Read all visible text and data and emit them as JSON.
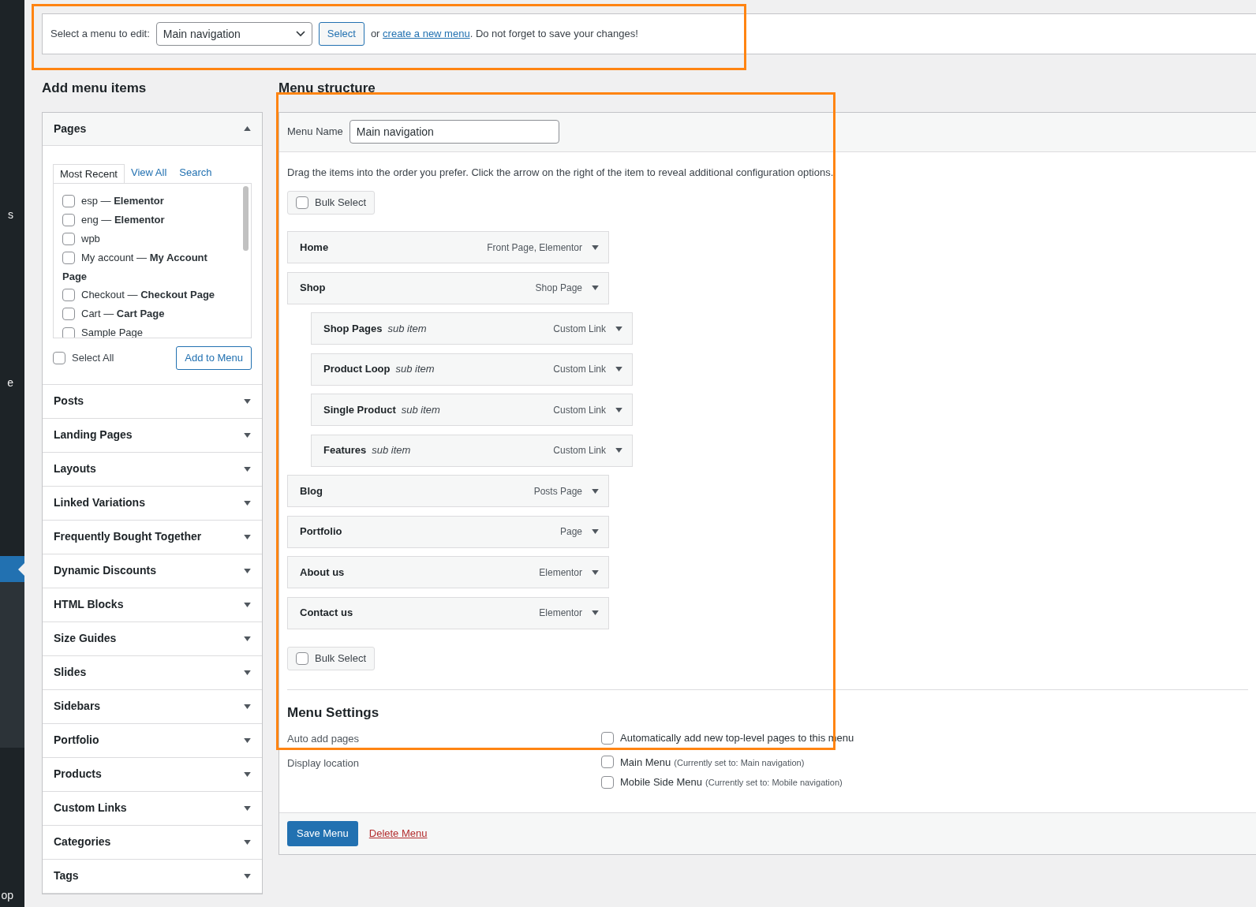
{
  "admin_sidebar": {
    "cut_labels": [
      "s",
      "e",
      "op"
    ]
  },
  "menu_select_bar": {
    "label": "Select a menu to edit:",
    "dropdown_value": "Main navigation",
    "button": "Select",
    "text_before_link": "or",
    "link": "create a new menu",
    "text_after_link": ". Do not forget to save your changes!"
  },
  "add_menu_items": {
    "title": "Add menu items",
    "panels": [
      {
        "title": "Pages",
        "expanded": true,
        "tabs": [
          {
            "label": "Most Recent",
            "selected": true
          },
          {
            "label": "View All",
            "selected": false
          },
          {
            "label": "Search",
            "selected": false
          }
        ],
        "items": [
          {
            "label": "esp — **Elementor**",
            "checked": false
          },
          {
            "label": "eng — **Elementor**",
            "checked": false
          },
          {
            "label": "wpb",
            "checked": false
          },
          {
            "label": "My account — **My Account Page**",
            "checked": false
          },
          {
            "label": "Checkout — **Checkout Page**",
            "checked": false
          },
          {
            "label": "Cart — **Cart Page**",
            "checked": false
          },
          {
            "label": "Sample Page",
            "checked": false
          }
        ],
        "select_all": {
          "label": "Select All",
          "checked": false
        },
        "add_button": "Add to Menu"
      },
      {
        "title": "Posts",
        "expanded": false
      },
      {
        "title": "Landing Pages",
        "expanded": false
      },
      {
        "title": "Layouts",
        "expanded": false
      },
      {
        "title": "Linked Variations",
        "expanded": false
      },
      {
        "title": "Frequently Bought Together",
        "expanded": false
      },
      {
        "title": "Dynamic Discounts",
        "expanded": false
      },
      {
        "title": "HTML Blocks",
        "expanded": false
      },
      {
        "title": "Size Guides",
        "expanded": false
      },
      {
        "title": "Slides",
        "expanded": false
      },
      {
        "title": "Sidebars",
        "expanded": false
      },
      {
        "title": "Portfolio",
        "expanded": false
      },
      {
        "title": "Products",
        "expanded": false
      },
      {
        "title": "Custom Links",
        "expanded": false
      },
      {
        "title": "Categories",
        "expanded": false
      },
      {
        "title": "Tags",
        "expanded": false
      }
    ]
  },
  "menu_structure": {
    "title": "Menu structure",
    "menu_name_label": "Menu Name",
    "menu_name_value": "Main navigation",
    "instructions": "Drag the items into the order you prefer. Click the arrow on the right of the item to reveal additional configuration options.",
    "bulk_select_top": {
      "label": "Bulk Select",
      "checked": false
    },
    "items": [
      {
        "title": "Home",
        "type": "Front Page, Elementor"
      },
      {
        "title": "Shop",
        "type": "Shop Page",
        "children": [
          {
            "title": "Shop Pages",
            "note": "sub item",
            "type": "Custom Link"
          },
          {
            "title": "Product Loop",
            "note": "sub item",
            "type": "Custom Link"
          },
          {
            "title": "Single Product",
            "note": "sub item",
            "type": "Custom Link"
          },
          {
            "title": "Features",
            "note": "sub item",
            "type": "Custom Link"
          }
        ]
      },
      {
        "title": "Blog",
        "type": "Posts Page"
      },
      {
        "title": "Portfolio",
        "type": "Page"
      },
      {
        "title": "About us",
        "type": "Elementor"
      },
      {
        "title": "Contact us",
        "type": "Elementor"
      }
    ],
    "bulk_select_bottom": {
      "label": "Bulk Select",
      "checked": false
    }
  },
  "menu_settings": {
    "title": "Menu Settings",
    "rows": [
      {
        "label": "Auto add pages",
        "options": [
          {
            "label": "Automatically add new top-level pages to this menu",
            "checked": false
          }
        ]
      },
      {
        "label": "Display location",
        "options": [
          {
            "label": "Main Menu",
            "note": "(Currently set to: Main navigation)",
            "checked": false
          },
          {
            "label": "Mobile Side Menu",
            "note": "(Currently set to: Mobile navigation)",
            "checked": false
          }
        ]
      }
    ]
  },
  "footer": {
    "save_button": "Save Menu",
    "delete_link": "Delete Menu"
  }
}
